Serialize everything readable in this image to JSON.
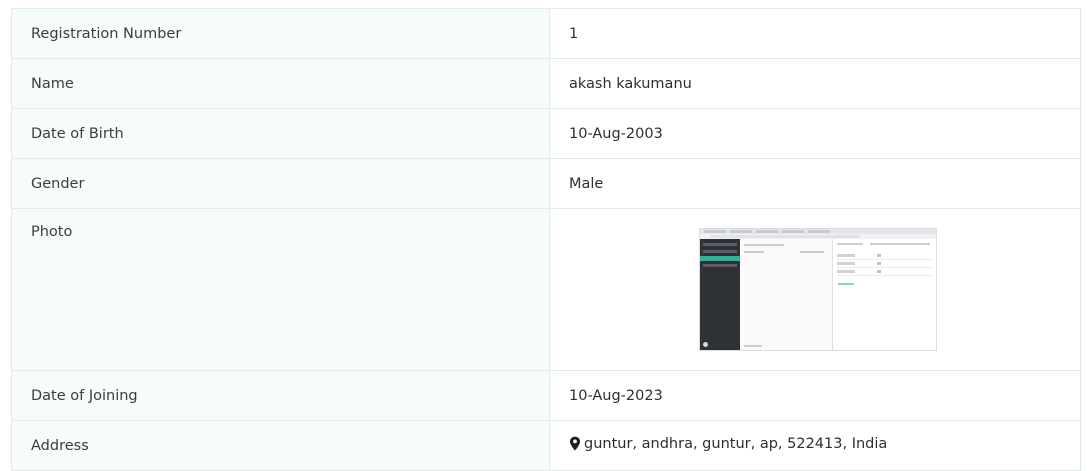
{
  "rows": [
    {
      "label": "Registration Number",
      "value": "1"
    },
    {
      "label": "Name",
      "value": "akash kakumanu"
    },
    {
      "label": "Date of Birth",
      "value": "10-Aug-2003"
    },
    {
      "label": "Gender",
      "value": "Male"
    },
    {
      "label": "Photo",
      "value_type": "image"
    },
    {
      "label": "Date of Joining",
      "value": "10-Aug-2023"
    },
    {
      "label": "Address",
      "value": "guntur, andhra, guntur, ap, 522413, India",
      "icon": "map-marker-icon"
    }
  ],
  "colors": {
    "label_bg": "#f6fbfb",
    "border": "#e4eaea",
    "text": "#3a3a3a"
  }
}
